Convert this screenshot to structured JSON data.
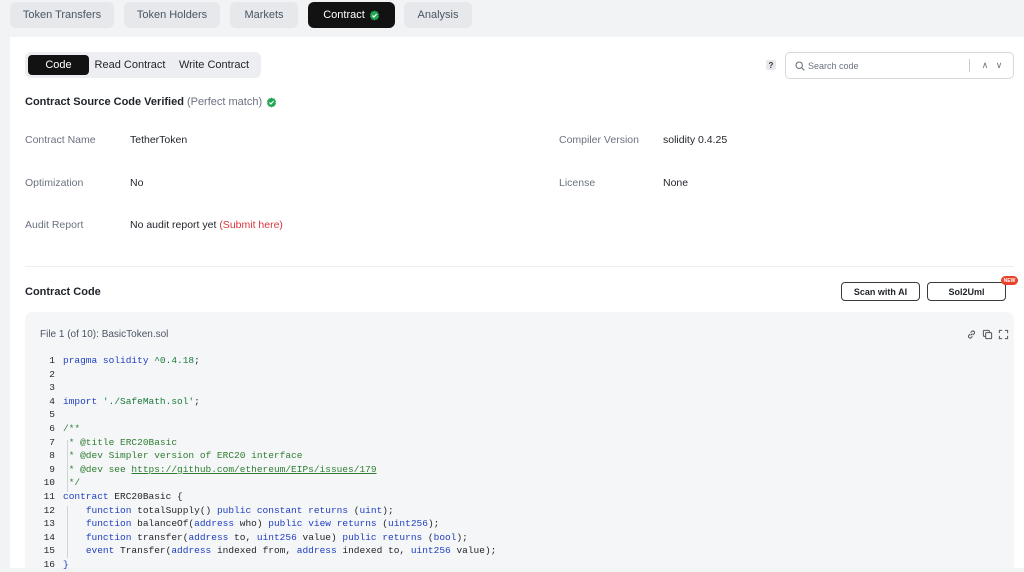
{
  "tabs": [
    {
      "label": "Token Transfers",
      "active": false
    },
    {
      "label": "Token Holders",
      "active": false
    },
    {
      "label": "Markets",
      "active": false
    },
    {
      "label": "Contract",
      "active": true
    },
    {
      "label": "Analysis",
      "active": false
    }
  ],
  "subtabs": [
    {
      "label": "Code",
      "active": true
    },
    {
      "label": "Read Contract",
      "active": false
    },
    {
      "label": "Write Contract",
      "active": false
    }
  ],
  "help_glyph": "?",
  "search": {
    "placeholder": "Search code",
    "prev_glyph": "∧",
    "next_glyph": "∨"
  },
  "verified": {
    "title": "Contract Source Code Verified",
    "match": "(Perfect match)"
  },
  "info": {
    "contract_name_label": "Contract Name",
    "contract_name": "TetherToken",
    "compiler_label": "Compiler Version",
    "compiler": "solidity 0.4.25",
    "optimization_label": "Optimization",
    "optimization": "No",
    "license_label": "License",
    "license": "None",
    "audit_label": "Audit Report",
    "audit_value": "No audit report yet",
    "audit_link": "(Submit here)"
  },
  "contract_code": {
    "title": "Contract Code",
    "scan_ai_label": "Scan with AI",
    "sol2uml_label": "Sol2Uml",
    "new_badge": "NEW"
  },
  "file": {
    "title": "File 1 (of 10): BasicToken.sol"
  },
  "colors": {
    "accent_dark": "#121212",
    "verified_green": "#22a652",
    "link_red": "#d9363e",
    "keyword_blue": "#1f3fbf",
    "comment_green": "#2f7d32"
  },
  "icons": [
    "help-icon",
    "search-icon",
    "verified-check-icon",
    "link-icon",
    "copy-icon",
    "expand-icon"
  ],
  "code_lines": [
    "1",
    "2",
    "3",
    "4",
    "5",
    "6",
    "7",
    "8",
    "9",
    "10",
    "11",
    "12",
    "13",
    "14",
    "15",
    "16"
  ],
  "code": {
    "l1_a": "pragma solidity",
    "l1_b": " ^0.4.18",
    "l1_c": ";",
    "l4_a": "import",
    "l4_b": " './SafeMath.sol'",
    "l4_c": ";",
    "l6": "/**",
    "l7": " * @title ERC20Basic",
    "l8": " * @dev Simpler version of ERC20 interface",
    "l9_a": " * @dev see ",
    "l9_b": "https://github.com/ethereum/EIPs/issues/179",
    "l10": " */",
    "l11_a": "contract",
    "l11_b": " ERC20Basic {",
    "l12": [
      "function",
      " totalSupply() ",
      "public constant returns",
      " (",
      "uint",
      ");"
    ],
    "l13": [
      "function",
      " balanceOf(",
      "address",
      " who) ",
      "public view returns",
      " (",
      "uint256",
      ");"
    ],
    "l14": [
      "function",
      " transfer(",
      "address",
      " to, ",
      "uint256",
      " value) ",
      "public returns",
      " (",
      "bool",
      ");"
    ],
    "l15": [
      "event",
      " Transfer(",
      "address",
      " indexed from, ",
      "address",
      " indexed to, ",
      "uint256",
      " value);"
    ],
    "l16": "}"
  }
}
